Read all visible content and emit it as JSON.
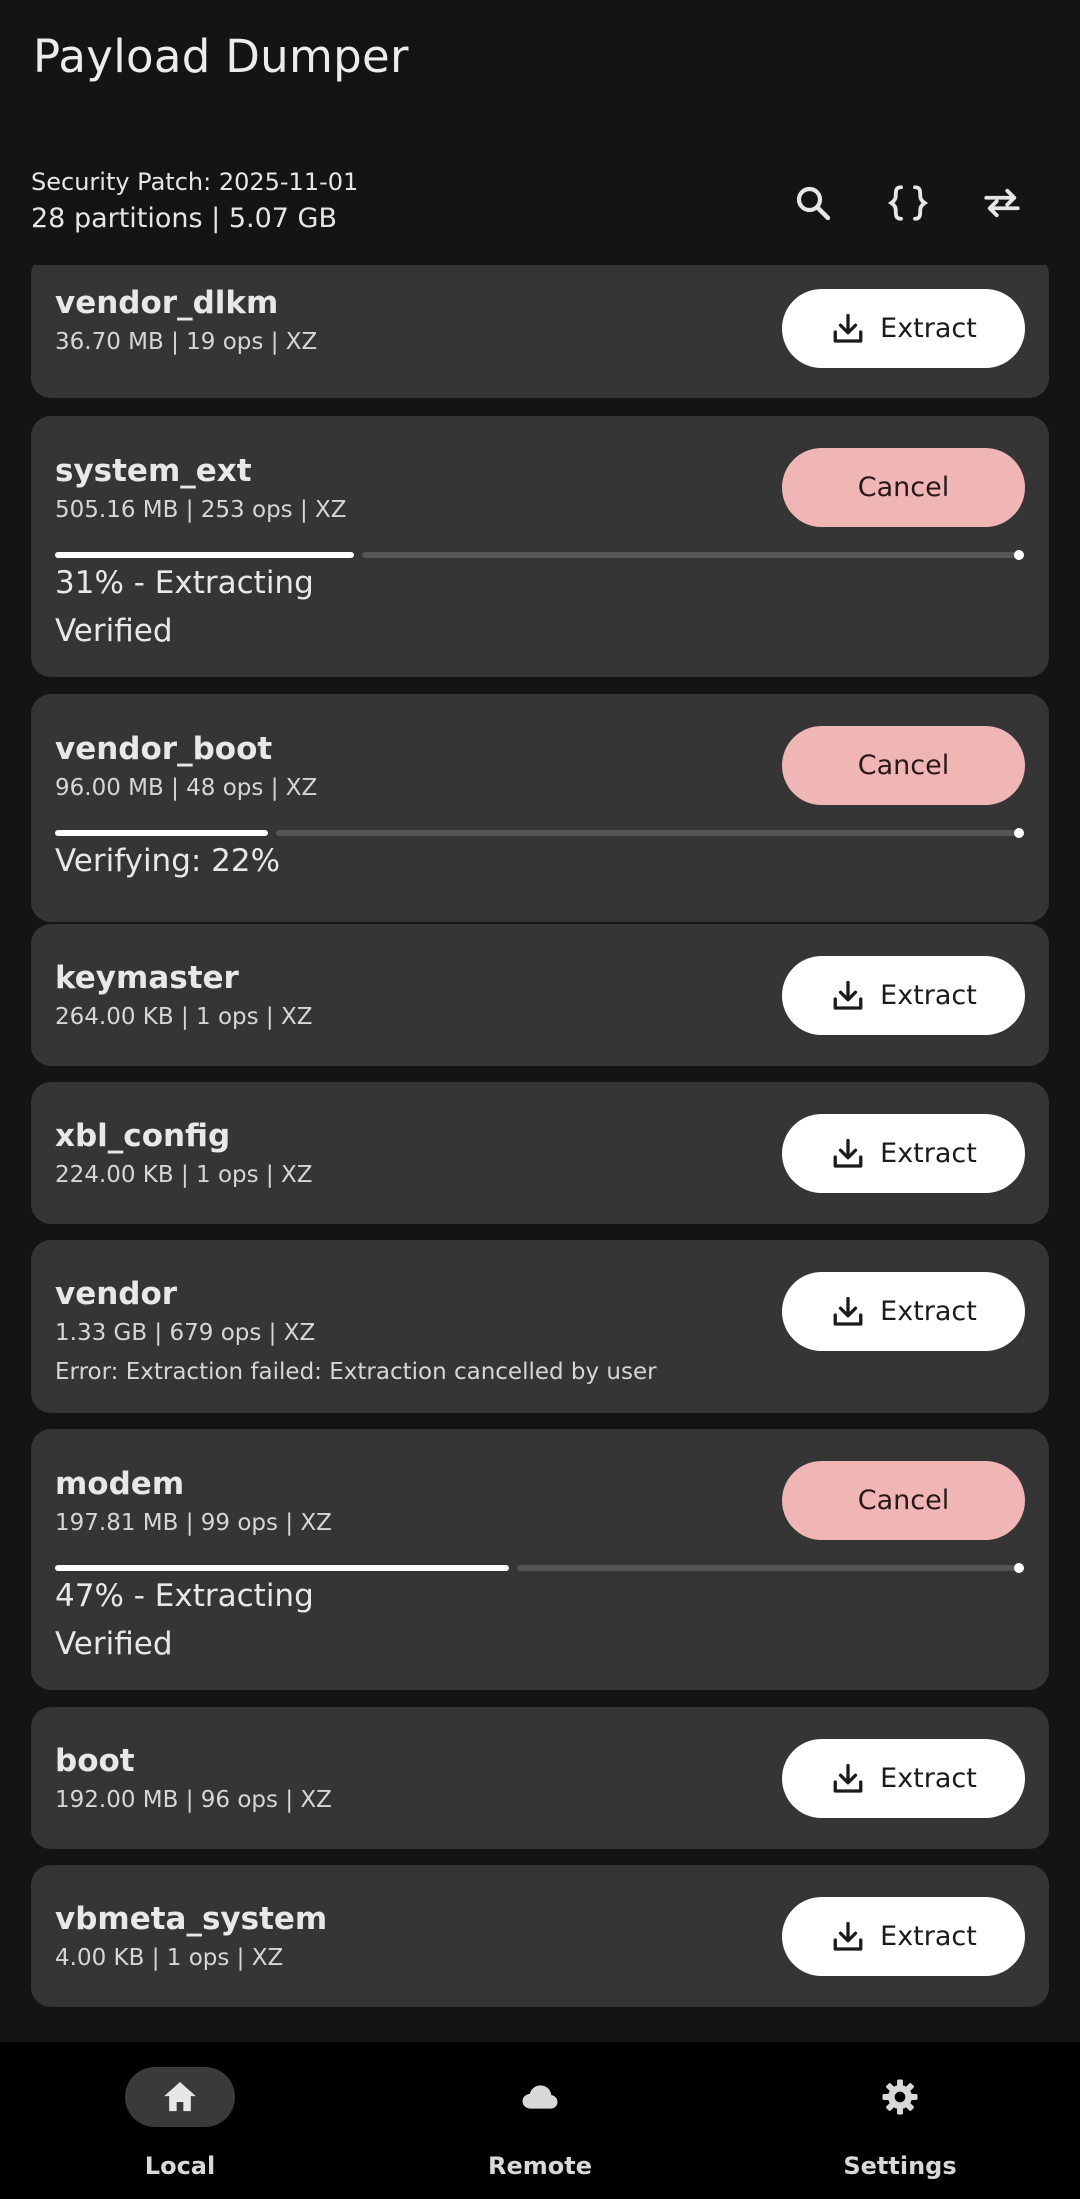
{
  "app": {
    "title": "Payload Dumper"
  },
  "header": {
    "security_patch": "Security Patch: 2025-11-01",
    "summary": "28 partitions | 5.07 GB"
  },
  "toolbar": {
    "icons": [
      "search-icon",
      "braces-icon",
      "swap-icon"
    ]
  },
  "partitions": [
    {
      "name": "vendor_dlkm",
      "meta": "36.70 MB | 19 ops | XZ",
      "action": "Extract"
    },
    {
      "name": "system_ext",
      "meta": "505.16 MB | 253 ops | XZ",
      "action": "Cancel",
      "progress": 0.31,
      "status": "31% - Extracting",
      "status2": "Verified"
    },
    {
      "name": "vendor_boot",
      "meta": "96.00 MB | 48 ops | XZ",
      "action": "Cancel",
      "progress": 0.22,
      "status": "Verifying: 22%"
    },
    {
      "name": "keymaster",
      "meta": "264.00 KB | 1 ops | XZ",
      "action": "Extract"
    },
    {
      "name": "xbl_config",
      "meta": "224.00 KB | 1 ops | XZ",
      "action": "Extract"
    },
    {
      "name": "vendor",
      "meta": "1.33 GB | 679 ops | XZ",
      "action": "Extract",
      "error": "Error: Extraction failed: Extraction cancelled by user"
    },
    {
      "name": "modem",
      "meta": "197.81 MB | 99 ops | XZ",
      "action": "Cancel",
      "progress": 0.47,
      "status": "47% - Extracting",
      "status2": "Verified"
    },
    {
      "name": "boot",
      "meta": "192.00 MB | 96 ops | XZ",
      "action": "Extract"
    },
    {
      "name": "vbmeta_system",
      "meta": "4.00 KB | 1 ops | XZ",
      "action": "Extract"
    }
  ],
  "nav": [
    {
      "label": "Local",
      "icon": "home-icon",
      "active": true
    },
    {
      "label": "Remote",
      "icon": "cloud-icon",
      "active": false
    },
    {
      "label": "Settings",
      "icon": "gear-icon",
      "active": false
    }
  ]
}
